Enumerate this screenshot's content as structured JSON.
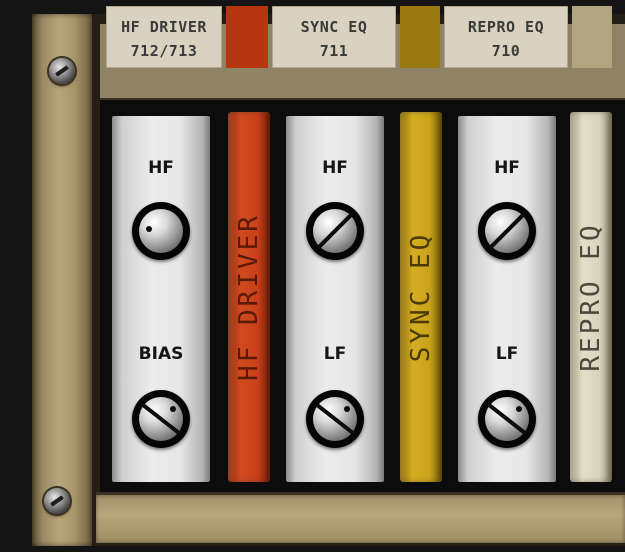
{
  "labels": [
    {
      "line1": "HF DRIVER",
      "line2": "712/713"
    },
    {
      "line1": "SYNC EQ",
      "line2": "711"
    },
    {
      "line1": "REPRO EQ",
      "line2": "710"
    }
  ],
  "modules": [
    {
      "top_knob_label": "HF",
      "bottom_knob_label": "BIAS"
    },
    {
      "top_knob_label": "HF",
      "bottom_knob_label": "LF"
    },
    {
      "top_knob_label": "HF",
      "bottom_knob_label": "LF"
    }
  ],
  "strips": [
    {
      "text": "HF DRIVER",
      "color": "#c8401a",
      "text_color": "#5a1a08"
    },
    {
      "text": "SYNC EQ",
      "color": "#c9a21a",
      "text_color": "#4a3a08"
    },
    {
      "text": "REPRO EQ",
      "color": "#d9d4bd",
      "text_color": "#4a4a40"
    }
  ],
  "colors": {
    "hf_driver": "#b8360f",
    "sync_eq": "#9a7a10",
    "repro_eq": "#b0a682",
    "rack_ear": "#b8a57b"
  }
}
